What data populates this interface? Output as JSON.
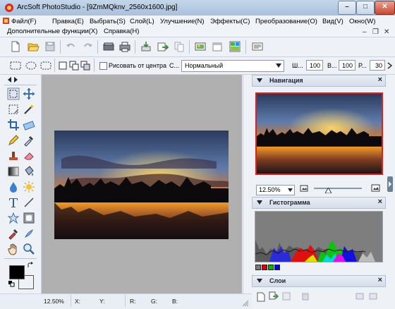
{
  "window": {
    "title": "ArcSoft PhotoStudio - [9ZmMQknv_2560x1600.jpg]",
    "minimize_symbol": "–",
    "maximize_symbol": "□",
    "close_symbol": "✕"
  },
  "menu": {
    "items": [
      "Файл(F)",
      "Правка(E)",
      "Выбрать(S)",
      "Слой(L)",
      "Улучшение(N)",
      "Эффекты(C)",
      "Преобразование(O)",
      "Вид(V)",
      "Окно(W)",
      "Дополнительные функции(X)",
      "Справка(H)"
    ],
    "ctrl_minimize": "–",
    "ctrl_restore": "❐",
    "ctrl_close": "✕"
  },
  "toolbar_icons": [
    "new-icon",
    "open-icon",
    "save-icon",
    "undo-icon",
    "redo-icon",
    "scan-icon",
    "print-icon",
    "import-icon",
    "export-icon",
    "copy-icon",
    "slideshow-icon",
    "calendar-icon",
    "layout-icon",
    "settings-icon"
  ],
  "options_bar": {
    "draw_from_center_label": "Рисовать от центра",
    "style_label": "С...",
    "style_value": "Нормальный",
    "width_label": "Ш...",
    "width_value": "100",
    "height_label": "В...",
    "height_value": "100",
    "r_label": "Р...",
    "r_value": "30"
  },
  "panels": {
    "navigation": {
      "title": "Навигация",
      "zoom_value": "12.50%"
    },
    "histogram": {
      "title": "Гистограмма",
      "channel_colors": [
        "#7a7a7a",
        "#e00000",
        "#00b000",
        "#0000e0"
      ]
    },
    "layers": {
      "title": "Слои"
    }
  },
  "status": {
    "zoom": "12.50%",
    "x_label": "X:",
    "y_label": "Y:",
    "r_label": "R:",
    "g_label": "G:",
    "b_label": "B:"
  },
  "colors": {
    "foreground": "#000000",
    "background": "#ffffff",
    "nav_frame": "#e02020"
  }
}
